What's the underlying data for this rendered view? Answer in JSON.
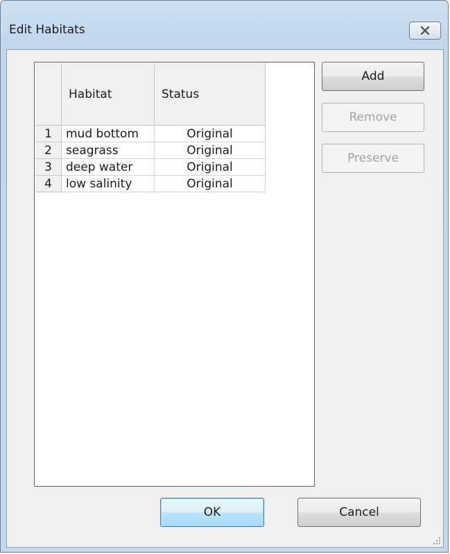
{
  "window": {
    "title": "Edit Habitats"
  },
  "grid": {
    "columns": [
      "Habitat",
      "Status"
    ],
    "rows": [
      {
        "num": "1",
        "habitat": "mud bottom",
        "status": "Original"
      },
      {
        "num": "2",
        "habitat": "seagrass",
        "status": "Original"
      },
      {
        "num": "3",
        "habitat": "deep water",
        "status": "Original"
      },
      {
        "num": "4",
        "habitat": "low salinity",
        "status": "Original"
      }
    ]
  },
  "buttons": {
    "add": "Add",
    "remove": "Remove",
    "preserve": "Preserve",
    "ok": "OK",
    "cancel": "Cancel"
  },
  "icons": {
    "close": "close-icon",
    "grip": "resize-grip-icon"
  }
}
